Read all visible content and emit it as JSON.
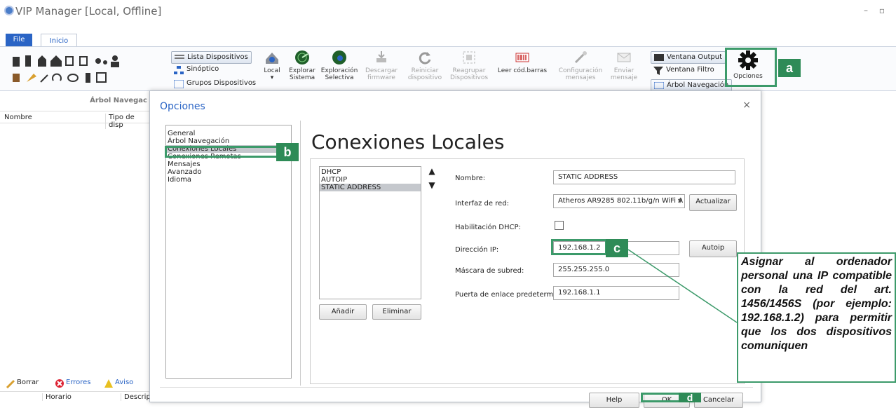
{
  "app": {
    "title": "VIP Manager [Local, Offline]",
    "window_controls": "– ▫"
  },
  "ribbon": {
    "tab_file": "File",
    "tab_inicio": "Inicio",
    "list_buttons": [
      "Lista Dispositivos",
      "Sinóptico",
      "Grupos Dispositivos"
    ],
    "buttons": [
      {
        "label1": "Local",
        "label2": "▾",
        "disabled": false
      },
      {
        "label1": "Explorar",
        "label2": "Sistema",
        "disabled": false
      },
      {
        "label1": "Exploración",
        "label2": "Selectiva",
        "disabled": false
      },
      {
        "label1": "Descargar",
        "label2": "firmware",
        "disabled": true
      },
      {
        "label1": "Reiniciar",
        "label2": "dispositivo",
        "disabled": true
      },
      {
        "label1": "Reagrupar",
        "label2": "Dispositivos",
        "disabled": true
      },
      {
        "label1": "Leer cód.barras",
        "label2": "",
        "disabled": false
      },
      {
        "label1": "Configuración",
        "label2": "mensajes",
        "disabled": true
      },
      {
        "label1": "Enviar",
        "label2": "mensaje",
        "disabled": true
      }
    ],
    "right_buttons": [
      "Ventana Output",
      "Ventana Filtro",
      "Árbol Navegación"
    ],
    "options_label": "Opciones"
  },
  "left_panel": {
    "header": "Árbol Navegac",
    "col_nombre": "Nombre",
    "col_tipo": "Tipo de disp"
  },
  "bottom": {
    "borrar": "Borrar",
    "errores": "Errores",
    "avisos": "Aviso",
    "col_horario": "Horario",
    "col_descr": "Descrip"
  },
  "dialog": {
    "title": "Opciones",
    "close": "×",
    "nav_items": [
      "General",
      "Árbol Navegación",
      "Conexiones Locales",
      "Conexiones Remotas",
      "Mensajes",
      "Avanzado",
      "Idioma"
    ],
    "nav_selected": 2,
    "heading": "Conexiones Locales",
    "connections": [
      "DHCP",
      "AUTOIP",
      "STATIC ADDRESS"
    ],
    "conn_selected": 2,
    "btn_add": "Añadir",
    "btn_remove": "Eliminar",
    "labels": {
      "nombre": "Nombre:",
      "interfaz": "Interfaz de red:",
      "dhcp": "Habilitación DHCP:",
      "ip": "Dirección IP:",
      "mask": "Máscara de subred:",
      "gateway": "Puerta de enlace predetermir"
    },
    "values": {
      "nombre": "STATIC ADDRESS",
      "interfaz": "Atheros AR9285 802.11b/g/n WiFi A",
      "ip": "192.168.1.2",
      "mask": "255.255.255.0",
      "gateway": "192.168.1.1"
    },
    "btn_actualizar": "Actualizar",
    "btn_autoip": "Autoip",
    "btn_help": "Help",
    "btn_ok": "OK",
    "btn_cancel": "Cancelar"
  },
  "callouts": {
    "a": "a",
    "b": "b",
    "c": "c",
    "d": "d"
  },
  "note": "Asignar al ordenador personal una IP compatible con la red del art. 1456/1456S (por ejemplo: 192.168.1.2) para permitir que los dos dispositivos comuniquen",
  "colors": {
    "accent": "#2a64c5",
    "callout": "#2e8b57",
    "highlight": "#3c9a6a"
  }
}
